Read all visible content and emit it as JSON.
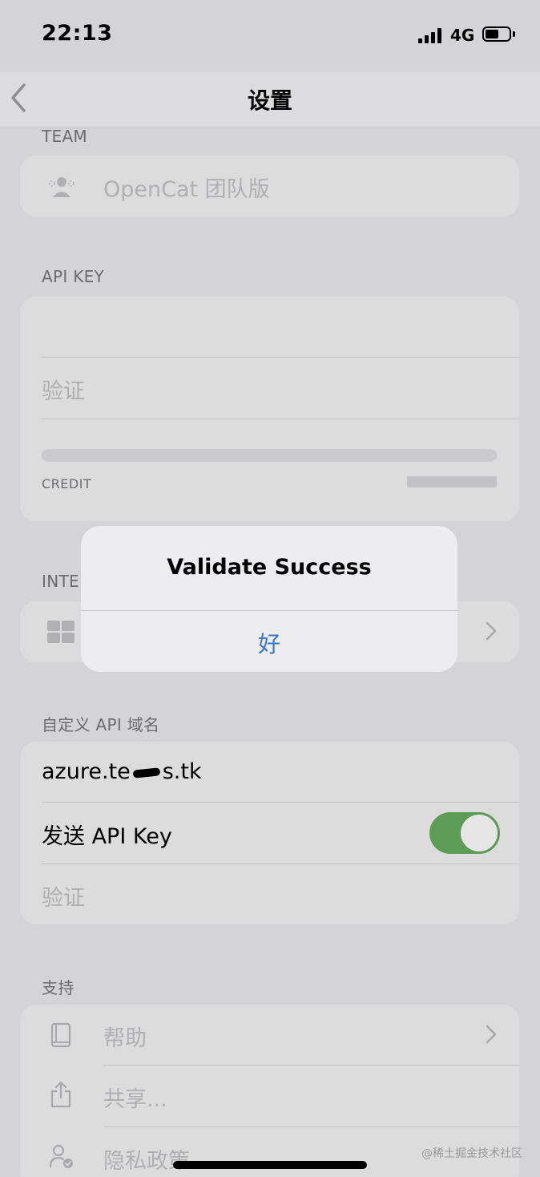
{
  "status_bar": {
    "time": "22:13",
    "network": "4G",
    "icons": [
      "signal-icon",
      "battery-icon"
    ]
  },
  "nav": {
    "title": "设置",
    "back_icon": "chevron-left-icon"
  },
  "team": {
    "header": "TEAM",
    "item_label": "OpenCat 团队版",
    "icon": "team-icon"
  },
  "api_key": {
    "header": "API KEY",
    "key_value": "",
    "validate_label": "验证",
    "credit_label": "CREDIT"
  },
  "integrations": {
    "header": "INTE",
    "icon": "grid-icon"
  },
  "alert": {
    "title": "Validate Success",
    "ok_label": "好"
  },
  "custom_domain": {
    "header": "自定义 API 域名",
    "domain_value": "azure.te",
    "domain_value_tail": "s.tk",
    "send_key_label": "发送 API Key",
    "send_key_enabled": true,
    "validate_label": "验证"
  },
  "support": {
    "header": "支持",
    "items": [
      {
        "label": "帮助",
        "icon": "book-icon"
      },
      {
        "label": "共享...",
        "icon": "share-icon"
      },
      {
        "label": "隐私政策",
        "icon": "privacy-icon"
      }
    ]
  },
  "watermark": "@稀土掘金技术社区",
  "colors": {
    "background": "#d4d4d6",
    "card": "#dcdcdd",
    "alert_button": "#3a76c8",
    "toggle_on": "#5c9c56"
  }
}
